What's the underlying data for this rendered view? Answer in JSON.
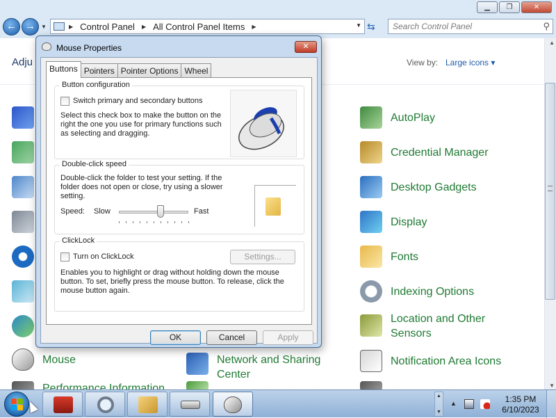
{
  "explorer": {
    "breadcrumb": [
      "Control Panel",
      "All Control Panel Items"
    ],
    "search_placeholder": "Search Control Panel",
    "adjust_text": "Adju",
    "view_by_label": "View by:",
    "view_by_value": "Large icons",
    "items_right": [
      {
        "label": "AutoPlay",
        "icon": "autoplay-icon"
      },
      {
        "label": "Credential Manager",
        "icon": "credential-manager-icon"
      },
      {
        "label": "Desktop Gadgets",
        "icon": "desktop-gadgets-icon"
      },
      {
        "label": "Display",
        "icon": "display-icon"
      },
      {
        "label": "Fonts",
        "icon": "fonts-icon"
      },
      {
        "label": "Indexing Options",
        "icon": "indexing-options-icon"
      },
      {
        "label": "Location and Other Sensors",
        "icon": "location-sensors-icon"
      },
      {
        "label": "Notification Area Icons",
        "icon": "notification-area-icon"
      }
    ],
    "items_bottom_left": [
      {
        "label": "Mouse",
        "icon": "mouse-icon"
      },
      {
        "label": "Performance Information",
        "icon": "performance-icon"
      }
    ],
    "items_bottom_mid": [
      {
        "label": "Network and Sharing Center",
        "icon": "network-sharing-icon"
      }
    ]
  },
  "dialog": {
    "title": "Mouse Properties",
    "tabs": [
      "Buttons",
      "Pointers",
      "Pointer Options",
      "Wheel"
    ],
    "active_tab": "Buttons",
    "button_config": {
      "title": "Button configuration",
      "checkbox_label": "Switch primary and secondary buttons",
      "checked": false,
      "description": "Select this check box to make the button on the right the one you use for primary functions such as selecting and dragging."
    },
    "double_click": {
      "title": "Double-click speed",
      "description": "Double-click the folder to test your setting. If the folder does not open or close, try using a slower setting.",
      "speed_label": "Speed:",
      "slow_label": "Slow",
      "fast_label": "Fast",
      "speed_value": 0.6
    },
    "clicklock": {
      "title": "ClickLock",
      "checkbox_label": "Turn on ClickLock",
      "checked": false,
      "settings_button": "Settings...",
      "description": "Enables you to highlight or drag without holding down the mouse button. To set, briefly press the mouse button. To release, click the mouse button again."
    },
    "buttons": {
      "ok": "OK",
      "cancel": "Cancel",
      "apply": "Apply"
    }
  },
  "taskbar": {
    "time": "1:35 PM",
    "date": "6/10/2023",
    "apps": [
      "toolbox-icon",
      "search-magnifier-icon",
      "folder-tasks-icon",
      "keyboard-icon",
      "mouse-icon"
    ]
  },
  "colors": {
    "link_green": "#1f7a33",
    "dialog_frame": "#c7daf0",
    "taskbar": "#a9c4e2"
  }
}
